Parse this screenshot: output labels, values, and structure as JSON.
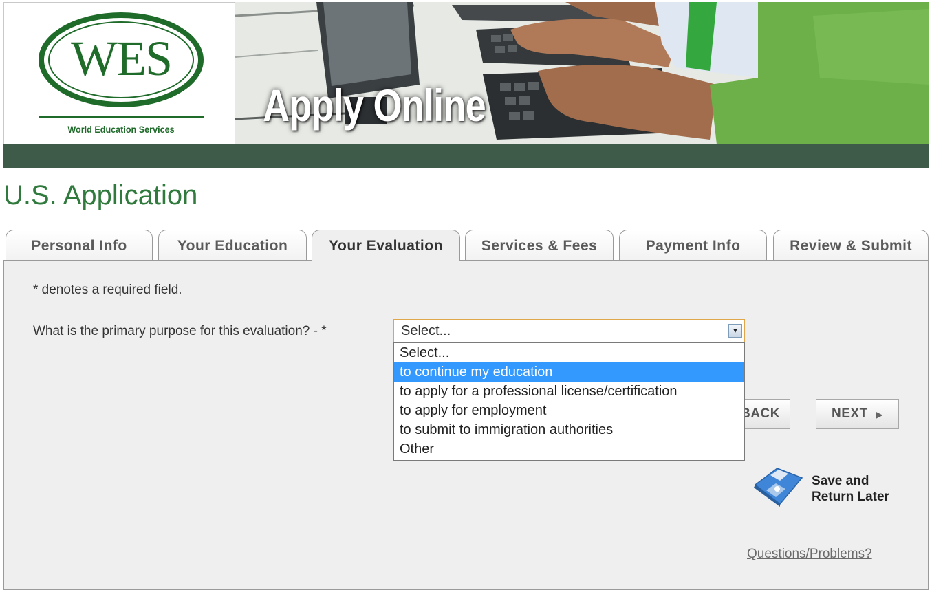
{
  "banner": {
    "logo_text": "WES",
    "logo_subtitle": "World Education Services",
    "title": "Apply Online"
  },
  "page_title": "U.S. Application",
  "tabs": [
    {
      "label": "Personal Info",
      "active": false
    },
    {
      "label": "Your Education",
      "active": false
    },
    {
      "label": "Your Evaluation",
      "active": true
    },
    {
      "label": "Services & Fees",
      "active": false
    },
    {
      "label": "Payment Info",
      "active": false
    },
    {
      "label": "Review & Submit",
      "active": false
    }
  ],
  "form": {
    "required_note": "* denotes a required field.",
    "question": "What is the primary purpose for this evaluation? - *",
    "select": {
      "value": "Select...",
      "options": [
        "Select...",
        "to continue my education",
        "to apply for a professional license/certification",
        "to apply for employment",
        "to submit to immigration authorities",
        "Other"
      ],
      "highlighted": "to continue my education"
    }
  },
  "buttons": {
    "back": "BACK",
    "next": "NEXT",
    "save_line1": "Save and",
    "save_line2": "Return Later"
  },
  "help_link": "Questions/Problems?",
  "colors": {
    "brand_green": "#1f6b2a",
    "title_green": "#2f7a3c",
    "banner_bar": "#3e5a48",
    "highlight": "#3399ff"
  }
}
